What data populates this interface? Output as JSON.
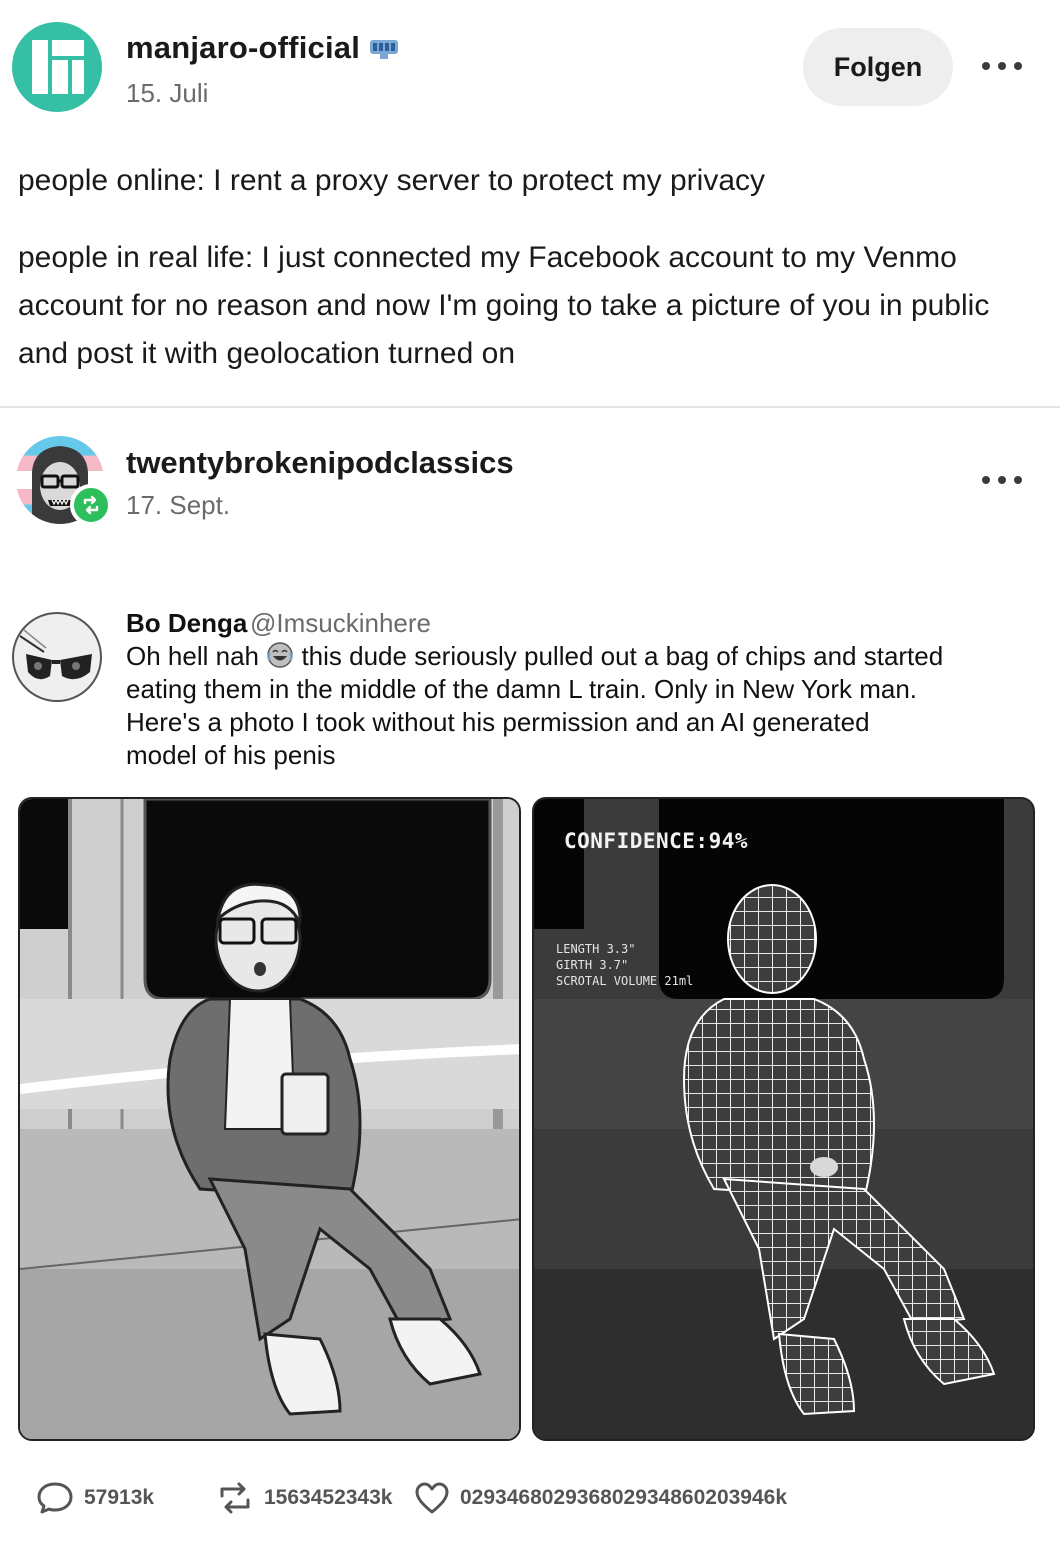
{
  "post": {
    "blog_name": "manjaro-official",
    "date": "15. Juli",
    "follow_label": "Folgen",
    "paragraph_1": "people online: I rent a proxy server to protect my privacy",
    "paragraph_2": "people in real life: I just connected my Facebook account to my Venmo account for no reason and now I'm going to take a picture of you in public and post it with geolocation turned on"
  },
  "reblog": {
    "blog_name": "twentybrokenipodclassics",
    "date": "17. Sept."
  },
  "tweet": {
    "name": "Bo Denga",
    "handle": "@Imsuckinhere",
    "text_before_emoji": "Oh hell nah",
    "text_after_emoji": "this dude seriously pulled out a bag of chips and started eating them in the middle of the damn L train. Only in New York man. Here's a photo I took without his permission and an AI generated model of his penis",
    "emoji": "face-with-tears-of-joy"
  },
  "image_right": {
    "confidence": "CONFIDENCE:94%",
    "length": "LENGTH 3.3\"",
    "girth": "GIRTH 3.7\"",
    "scrotal_volume": "SCROTAL VOLUME 21ml"
  },
  "stats": {
    "replies": "57913k",
    "reblogs": "1563452343k",
    "likes": "029346802936802934860203946k"
  },
  "colors": {
    "accent_teal": "#35bfa4",
    "reblog_green": "#2dbf5c",
    "muted_text": "#6b6b6b"
  }
}
